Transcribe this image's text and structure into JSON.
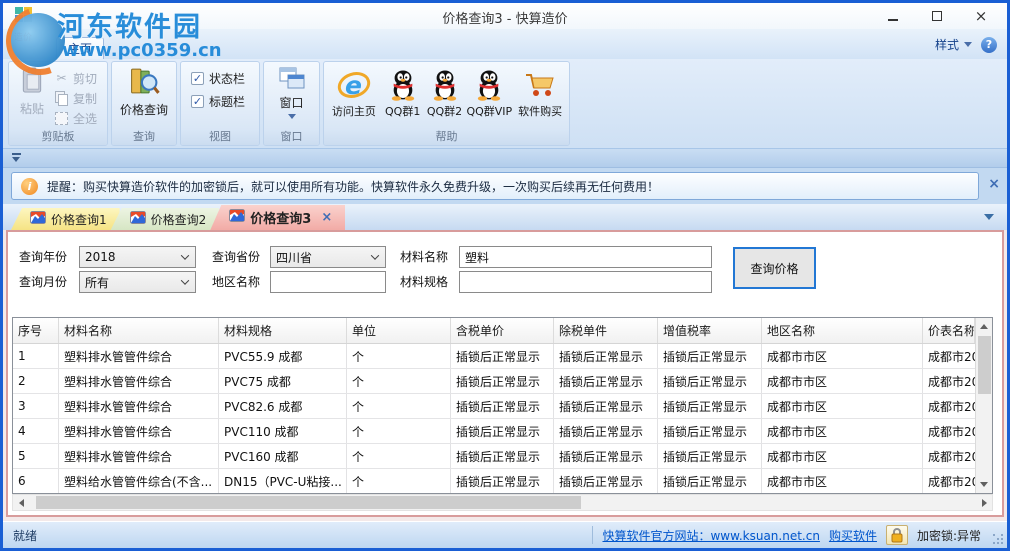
{
  "window": {
    "title": "价格查询3 - 快算造价",
    "app_label": "造价",
    "close_glyph": "×"
  },
  "watermark": {
    "site_name": "河东软件园",
    "site_url": "www.pc0359.cn"
  },
  "ribbon": {
    "home_tab": "主页",
    "style_label": "样式",
    "help_glyph": "?",
    "clipboard": {
      "label": "剪贴板",
      "paste": "粘贴",
      "cut": "剪切",
      "copy": "复制",
      "select_all": "全选",
      "cut_glyph": "✂"
    },
    "query": {
      "label": "查询",
      "price_query": "价格查询"
    },
    "view": {
      "label": "视图",
      "status_bar": "状态栏",
      "title_bar": "标题栏",
      "check_glyph": "✓"
    },
    "window_group": {
      "label": "窗口",
      "window": "窗口"
    },
    "help": {
      "label": "帮助",
      "visit_home": "访问主页",
      "qq1": "QQ群1",
      "qq2": "QQ群2",
      "qqvip": "QQ群VIP",
      "buy": "软件购买"
    }
  },
  "notice": {
    "info_glyph": "i",
    "text": "提醒：购买快算造价软件的加密锁后，就可以使用所有功能。快算软件永久免费升级，一次购买后续再无任何费用！",
    "close_glyph": "×"
  },
  "tab_bar": {
    "tabs": [
      {
        "label": "价格查询1"
      },
      {
        "label": "价格查询2"
      },
      {
        "label": "价格查询3"
      }
    ],
    "close_glyph": "×"
  },
  "query_form": {
    "year_label": "查询年份",
    "year_value": "2018",
    "month_label": "查询月份",
    "month_value": "所有",
    "province_label": "查询省份",
    "province_value": "四川省",
    "region_label": "地区名称",
    "region_value": "",
    "material_label": "材料名称",
    "material_value": "塑料",
    "spec_label": "材料规格",
    "spec_value": "",
    "search_button": "查询价格"
  },
  "table": {
    "columns": [
      "序号",
      "材料名称",
      "材料规格",
      "单位",
      "含税单价",
      "除税单件",
      "增值税率",
      "地区名称",
      "价表名称"
    ],
    "rows": [
      [
        "1",
        "塑料排水管管件综合",
        "PVC55.9 成都",
        "个",
        "插锁后正常显示",
        "插锁后正常显示",
        "插锁后正常显示",
        "成都市市区",
        "成都市20"
      ],
      [
        "2",
        "塑料排水管管件综合",
        "PVC75 成都",
        "个",
        "插锁后正常显示",
        "插锁后正常显示",
        "插锁后正常显示",
        "成都市市区",
        "成都市20"
      ],
      [
        "3",
        "塑料排水管管件综合",
        "PVC82.6 成都",
        "个",
        "插锁后正常显示",
        "插锁后正常显示",
        "插锁后正常显示",
        "成都市市区",
        "成都市20"
      ],
      [
        "4",
        "塑料排水管管件综合",
        "PVC110 成都",
        "个",
        "插锁后正常显示",
        "插锁后正常显示",
        "插锁后正常显示",
        "成都市市区",
        "成都市20"
      ],
      [
        "5",
        "塑料排水管管件综合",
        "PVC160 成都",
        "个",
        "插锁后正常显示",
        "插锁后正常显示",
        "插锁后正常显示",
        "成都市市区",
        "成都市20"
      ],
      [
        "6",
        "塑料给水管管件综合(不含...",
        "DN15（PVC-U粘接...",
        "个",
        "插锁后正常显示",
        "插锁后正常显示",
        "插锁后正常显示",
        "成都市市区",
        "成都市20"
      ]
    ]
  },
  "status_bar": {
    "ready": "就绪",
    "website_link": "快算软件官方网站：www.ksuan.net.cn",
    "buy_link": "购买软件",
    "lock_status": "加密锁:异常"
  },
  "colors": {
    "window_border": "#1A5FD4",
    "accent_text": "#15428B",
    "link": "#0055CC",
    "tab1_bg": "#F5E384",
    "tab2_bg": "#D6E6C4",
    "tab3_bg": "#F2ABA6",
    "panel_border": "#D89C9C",
    "notice_border": "#7FA8D9",
    "lock_gold": "#F0B020"
  }
}
